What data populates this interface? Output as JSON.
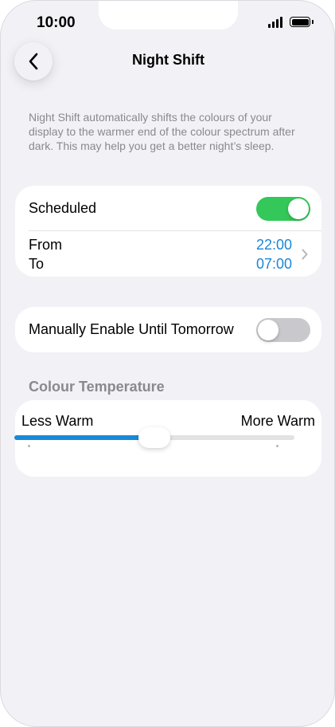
{
  "status_bar": {
    "time": "10:00",
    "signal_icon": "cellular-signal-icon",
    "battery_icon": "battery-full-icon"
  },
  "nav": {
    "back_icon": "chevron-left-icon",
    "title": "Night Shift"
  },
  "description": "Night Shift automatically shifts the colours of your display to the warmer end of the colour spectrum after dark. This may help you get a better night’s sleep.",
  "schedule": {
    "label": "Scheduled",
    "enabled": true,
    "from_label": "From",
    "to_label": "To",
    "from_time": "22:00",
    "to_time": "07:00",
    "chevron_icon": "chevron-right-icon"
  },
  "manual": {
    "label": "Manually Enable Until Tomorrow",
    "enabled": false
  },
  "colour_temperature": {
    "header": "Colour Temperature",
    "min_label": "Less Warm",
    "max_label": "More Warm",
    "value_fraction": 0.5
  },
  "colors": {
    "accent_blue": "#1a88d8",
    "toggle_on_green": "#34c759",
    "toggle_off_gray": "#c9c9cd",
    "background": "#f2f1f6",
    "secondary_text": "#8a8a8e"
  }
}
